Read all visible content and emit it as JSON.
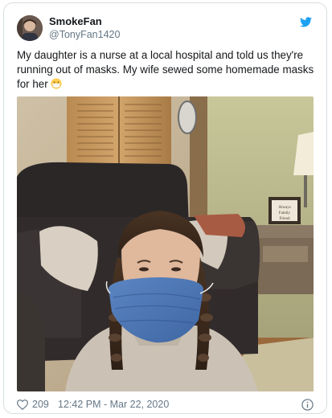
{
  "tweet": {
    "display_name": "SmokeFan",
    "handle": "@TonyFan1420",
    "text": "My daughter is a nurse at a local hospital and told us they're running out of masks. My wife sewed some homemade masks for her",
    "emoji": "face-with-medical-mask-emoji",
    "likes": "209",
    "timestamp": "12:42 PM - Mar 22, 2020",
    "frame_text": "Always Family Friend"
  },
  "icons": {
    "brand": "twitter-logo-icon",
    "like": "heart-icon",
    "info": "info-icon"
  },
  "colors": {
    "twitter_blue": "#1da1f2",
    "secondary_text": "#657786",
    "primary_text": "#14171a",
    "border": "#d8dee2"
  }
}
